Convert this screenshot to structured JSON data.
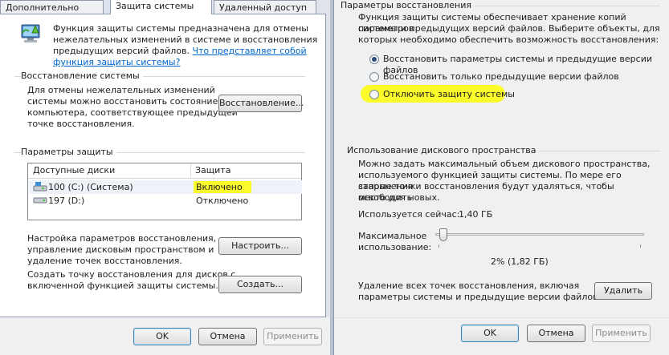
{
  "left": {
    "tabs": [
      {
        "label": "Дополнительно"
      },
      {
        "label": "Защита системы"
      },
      {
        "label": "Удаленный доступ"
      }
    ],
    "intro": {
      "line1": "Функция защиты системы предназначена для отмены",
      "line2": "нежелательных изменений в системе и восстановления",
      "line3_prefix": "предыдущих версий файлов.",
      "link_part1": "Что представляет собой",
      "link_part2": "функция защиты системы?"
    },
    "restore": {
      "title": "Восстановление системы",
      "line1": "Для отмены нежелательных изменений",
      "line2": "системы можно восстановить состояние",
      "line3": "компьютера, соответствующее предыдущей",
      "line4": "точке восстановления.",
      "button": "Восстановление..."
    },
    "protection": {
      "title": "Параметры защиты",
      "columns": [
        "Доступные диски",
        "Защита"
      ],
      "rows": [
        {
          "drive": "100 (C:) (Система)",
          "status": "Включено"
        },
        {
          "drive": "197 (D:)",
          "status": "Отключено"
        }
      ],
      "configure_line1": "Настройка параметров восстановления,",
      "configure_line2": "управление дисковым пространством и",
      "configure_line3": "удаление точек восстановления.",
      "configure_button": "Настроить...",
      "create_line1": "Создать точку восстановления для дисков с",
      "create_line2": "включенной функцией защиты системы.",
      "create_button": "Создать..."
    },
    "buttons": {
      "ok": "OK",
      "cancel": "Отмена",
      "apply": "Применить"
    }
  },
  "right": {
    "restore_settings": {
      "title": "Параметры восстановления",
      "line1": "Функция защиты системы обеспечивает хранение копий параметров",
      "line2": "системы и предыдущих версий файлов. Выберите объекты, для",
      "line3": "которых необходимо обеспечить возможность восстановления:",
      "options": [
        {
          "label": "Восстановить параметры системы и предыдущие версии файлов",
          "checked": true
        },
        {
          "label": "Восстановить только предыдущие версии файлов",
          "checked": false
        },
        {
          "label": "Отключить защиту системы",
          "checked": false
        }
      ]
    },
    "disk_usage": {
      "title": "Использование дискового пространства",
      "line1": "Можно задать максимальный объем дискового пространства,",
      "line2": "используемого функцией защиты системы. По мере его заполнения",
      "line3": "старые точки восстановления будут удаляться, чтобы освободить",
      "line4": "место для новых.",
      "current_label": "Используется сейчас:",
      "current_value": "1,40 ГБ",
      "max_label_line1": "Максимальное",
      "max_label_line2": "использование:",
      "slider_value_percent": 2,
      "slider_readout": "2% (1,82 ГБ)"
    },
    "delete": {
      "line1": "Удаление всех точек восстановления, включая",
      "line2": "параметры системы и предыдущие версии файлов.",
      "button": "Удалить"
    },
    "buttons": {
      "ok": "OK",
      "cancel": "Отмена",
      "apply": "Применить"
    }
  },
  "colors": {
    "highlight": "#fbfb2c",
    "link": "#0066cc"
  }
}
